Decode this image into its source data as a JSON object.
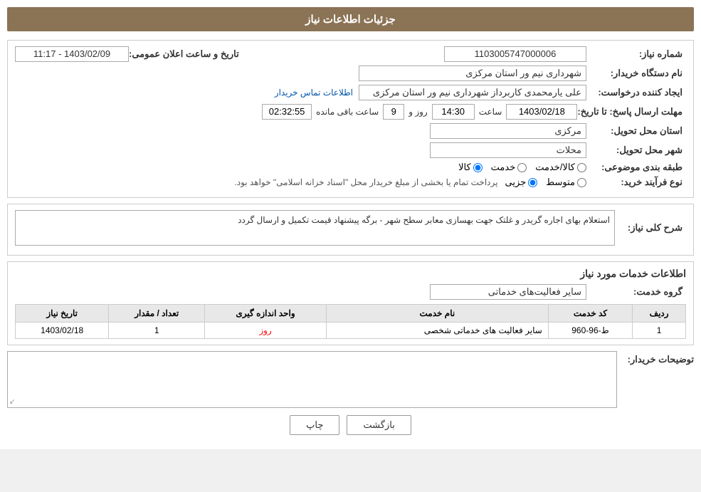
{
  "header": {
    "title": "جزئیات اطلاعات نیاز"
  },
  "main_info": {
    "need_number_label": "شماره نیاز:",
    "need_number_value": "1103005747000006",
    "announce_date_label": "تاریخ و ساعت اعلان عمومی:",
    "announce_date_value": "1403/02/09 - 11:17",
    "buyer_org_label": "نام دستگاه خریدار:",
    "buyer_org_value": "شهرداری نیم ور استان مرکزی",
    "requester_label": "ایجاد کننده درخواست:",
    "requester_value": "علی یارمحمدی کاربرداز شهرداری نیم ور استان مرکزی",
    "contact_link_text": "اطلاعات تماس خریدار",
    "response_deadline_label": "مهلت ارسال پاسخ: تا تاریخ:",
    "response_date_value": "1403/02/18",
    "response_time_value": "14:30",
    "response_time_label": "ساعت",
    "response_days_value": "9",
    "response_days_label": "روز و",
    "response_remaining_value": "02:32:55",
    "response_remaining_label": "ساعت باقی مانده",
    "delivery_province_label": "استان محل تحویل:",
    "delivery_province_value": "مرکزی",
    "delivery_city_label": "شهر محل تحویل:",
    "delivery_city_value": "محلات",
    "category_label": "طبقه بندی موضوعی:",
    "category_kala": "کالا",
    "category_khedmat": "خدمت",
    "category_kala_khedmat": "کالا/خدمت",
    "process_type_label": "نوع فرآیند خرید:",
    "process_jozyi": "جزیی",
    "process_motavasset": "متوسط",
    "process_note": "پرداخت تمام یا بخشی از مبلغ خریدار محل \"اسناد خزانه اسلامی\" خواهد بود."
  },
  "description": {
    "label": "شرح کلی نیاز:",
    "value": "استعلام بهای اجاره گریدر و غلتک جهت بهسازی معابر سطح شهر - برگه پیشنهاد قیمت تکمیل و ارسال گردد"
  },
  "services": {
    "section_title": "اطلاعات خدمات مورد نیاز",
    "group_label": "گروه خدمت:",
    "group_value": "سایر فعالیت‌های خدماتی",
    "table": {
      "columns": [
        "ردیف",
        "کد خدمت",
        "نام خدمت",
        "واحد اندازه گیری",
        "تعداد / مقدار",
        "تاریخ نیاز"
      ],
      "rows": [
        {
          "row_num": "1",
          "code": "ط-96-960",
          "name": "سایر فعالیت های خدماتی شخصی",
          "unit": "روز",
          "quantity": "1",
          "date": "1403/02/18"
        }
      ]
    }
  },
  "buyer_notes": {
    "label": "توضیحات خریدار:",
    "value": ""
  },
  "buttons": {
    "print_label": "چاپ",
    "back_label": "بازگشت"
  }
}
